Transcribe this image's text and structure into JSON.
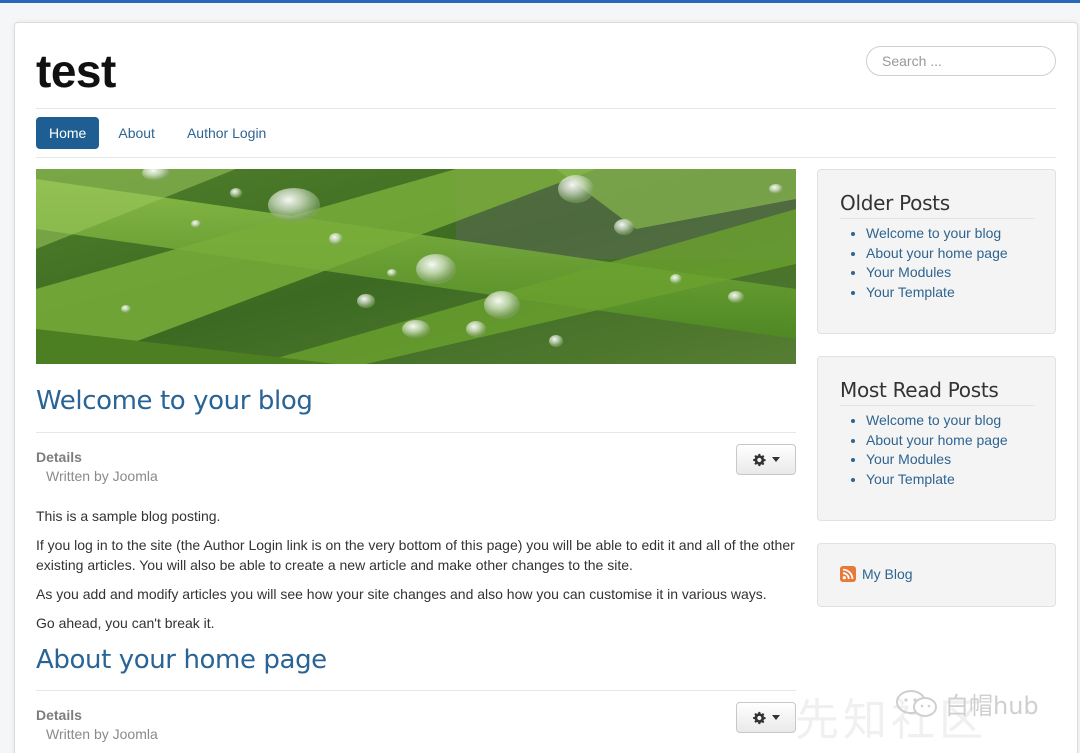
{
  "site": {
    "title": "test"
  },
  "search": {
    "placeholder": "Search ..."
  },
  "nav": {
    "items": [
      {
        "label": "Home",
        "active": true
      },
      {
        "label": "About"
      },
      {
        "label": "Author Login"
      }
    ]
  },
  "articles": [
    {
      "title": "Welcome to your blog",
      "details_label": "Details",
      "author": "Written by Joomla",
      "paragraphs": [
        "This is a sample blog posting.",
        "If you log in to the site (the Author Login link is on the very bottom of this page) you will be able to edit it and all of the other existing articles. You will also be able to create a new article and make other changes to the site.",
        "As you add and modify articles you will see how your site changes and also how you can customise it in various ways.",
        "Go ahead, you can't break it."
      ]
    },
    {
      "title": "About your home page",
      "details_label": "Details",
      "author": "Written by Joomla"
    }
  ],
  "sidebar": {
    "older_posts": {
      "title": "Older Posts",
      "items": [
        "Welcome to your blog",
        "About your home page",
        "Your Modules",
        "Your Template"
      ]
    },
    "most_read": {
      "title": "Most Read Posts",
      "items": [
        "Welcome to your blog",
        "About your home page",
        "Your Modules",
        "Your Template"
      ]
    },
    "feed": {
      "label": "My Blog",
      "icon": "rss-icon"
    }
  },
  "watermark": {
    "text": "白帽hub",
    "faint_text": "先知社区"
  },
  "colors": {
    "accent": "#1f5e92",
    "link": "#2f6491",
    "heading": "#2a6496"
  }
}
